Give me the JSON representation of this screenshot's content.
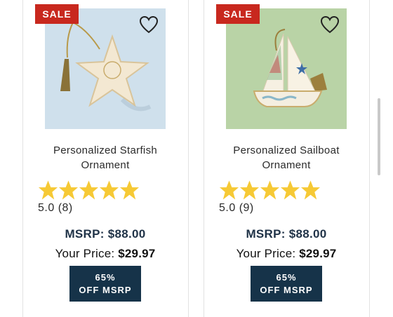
{
  "products": [
    {
      "badge": "SALE",
      "title_line1": "Personalized Starfish",
      "title_line2": "Ornament",
      "rating": "5.0",
      "review_count": "(8)",
      "stars": 5,
      "msrp": "MSRP: $88.00",
      "your_price_label": "Your Price:",
      "your_price_value": "$29.97",
      "discount_line1": "65%",
      "discount_line2": "OFF MSRP",
      "wishlist_icon": "heart-outline-icon",
      "image_bg": "#cfe0ec"
    },
    {
      "badge": "SALE",
      "title_line1": "Personalized Sailboat",
      "title_line2": "Ornament",
      "rating": "5.0",
      "review_count": "(9)",
      "stars": 5,
      "msrp": "MSRP: $88.00",
      "your_price_label": "Your Price:",
      "your_price_value": "$29.97",
      "discount_line1": "65%",
      "discount_line2": "OFF MSRP",
      "wishlist_icon": "heart-outline-icon",
      "image_bg": "#b9d3a6"
    }
  ],
  "colors": {
    "sale_badge": "#c8281e",
    "star": "#f6c935",
    "discount_bg": "#163349",
    "msrp_text": "#1f3247"
  }
}
